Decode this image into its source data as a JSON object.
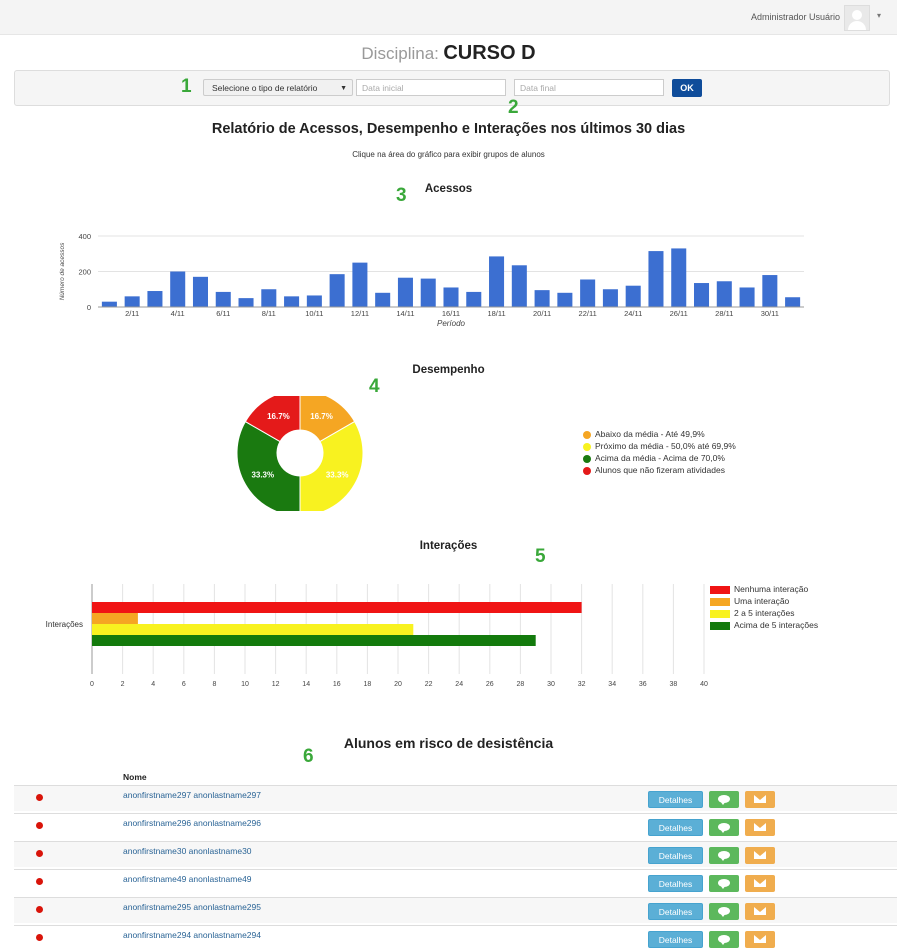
{
  "header": {
    "user_name": "Administrador Usuário",
    "caret": "▾"
  },
  "course": {
    "label": "Disciplina:",
    "name": "CURSO D"
  },
  "filters": {
    "report_type_label": "Selecione o tipo de relatório",
    "start_date_placeholder": "Data inicial",
    "end_date_placeholder": "Data final",
    "ok_label": "OK"
  },
  "markers": {
    "m1": "1",
    "m2": "2",
    "m3": "3",
    "m4": "4",
    "m5": "5",
    "m6": "6"
  },
  "report": {
    "title": "Relatório de Acessos, Desempenho e Interações nos últimos 30 dias",
    "subtitle": "Clique na área do gráfico para exibir grupos de alunos"
  },
  "chart_data": [
    {
      "type": "bar",
      "title": "Acessos",
      "xlabel": "Período",
      "ylabel": "Número de acessos",
      "ylim": [
        0,
        400
      ],
      "yticks": [
        0,
        200,
        400
      ],
      "categories": [
        "1/11",
        "2/11",
        "3/11",
        "4/11",
        "5/11",
        "6/11",
        "7/11",
        "8/11",
        "9/11",
        "10/11",
        "11/11",
        "12/11",
        "13/11",
        "14/11",
        "15/11",
        "16/11",
        "17/11",
        "18/11",
        "19/11",
        "20/11",
        "21/11",
        "22/11",
        "23/11",
        "24/11",
        "25/11",
        "26/11",
        "27/11",
        "28/11",
        "29/11",
        "30/11",
        "1/12"
      ],
      "x_tick_labels": [
        "2/11",
        "4/11",
        "6/11",
        "8/11",
        "10/11",
        "12/11",
        "14/11",
        "16/11",
        "18/11",
        "20/11",
        "22/11",
        "24/11",
        "26/11",
        "28/11",
        "30/11"
      ],
      "values": [
        30,
        60,
        90,
        200,
        170,
        85,
        50,
        100,
        60,
        65,
        185,
        250,
        80,
        165,
        160,
        110,
        85,
        285,
        235,
        95,
        80,
        155,
        100,
        120,
        315,
        330,
        135,
        145,
        110,
        180,
        55
      ],
      "color": "#3c6fd1",
      "grid": true
    },
    {
      "type": "pie",
      "title": "Desempenho",
      "labels": [
        "Abaixo da média - Até 49,9%",
        "Próximo da média - 50,0% até 69,9%",
        "Acima da média - Acima de 70,0%",
        "Alunos que não fizeram atividades"
      ],
      "values": [
        16.7,
        33.3,
        33.3,
        16.7
      ],
      "value_labels": [
        "16.7%",
        "33.3%",
        "33.3%",
        "16.7%"
      ],
      "colors": [
        "#f5a623",
        "#f8f220",
        "#1a7a10",
        "#e41a1a"
      ],
      "legend": "right"
    },
    {
      "type": "bar",
      "orientation": "horizontal",
      "title": "Interações",
      "categories": [
        "Interações"
      ],
      "series": [
        {
          "name": "Nenhuma interação",
          "values": [
            32
          ],
          "color": "#f01414"
        },
        {
          "name": "Uma interação",
          "values": [
            3
          ],
          "color": "#f5a623"
        },
        {
          "name": "2 a 5 interações",
          "values": [
            21
          ],
          "color": "#f8f220"
        },
        {
          "name": "Acima de 5 interações",
          "values": [
            29
          ],
          "color": "#137a0c"
        }
      ],
      "xlim": [
        0,
        40
      ],
      "xticks": [
        0,
        2,
        4,
        6,
        8,
        10,
        12,
        14,
        16,
        18,
        20,
        22,
        24,
        26,
        28,
        30,
        32,
        34,
        36,
        38,
        40
      ],
      "legend": "right",
      "grid": true
    }
  ],
  "risk": {
    "title": "Alunos em risco de desistência",
    "column_name": "Nome",
    "details_label": "Detalhes",
    "students": [
      "anonfirstname297 anonlastname297",
      "anonfirstname296 anonlastname296",
      "anonfirstname30 anonlastname30",
      "anonfirstname49 anonlastname49",
      "anonfirstname295 anonlastname295",
      "anonfirstname294 anonlastname294"
    ]
  }
}
